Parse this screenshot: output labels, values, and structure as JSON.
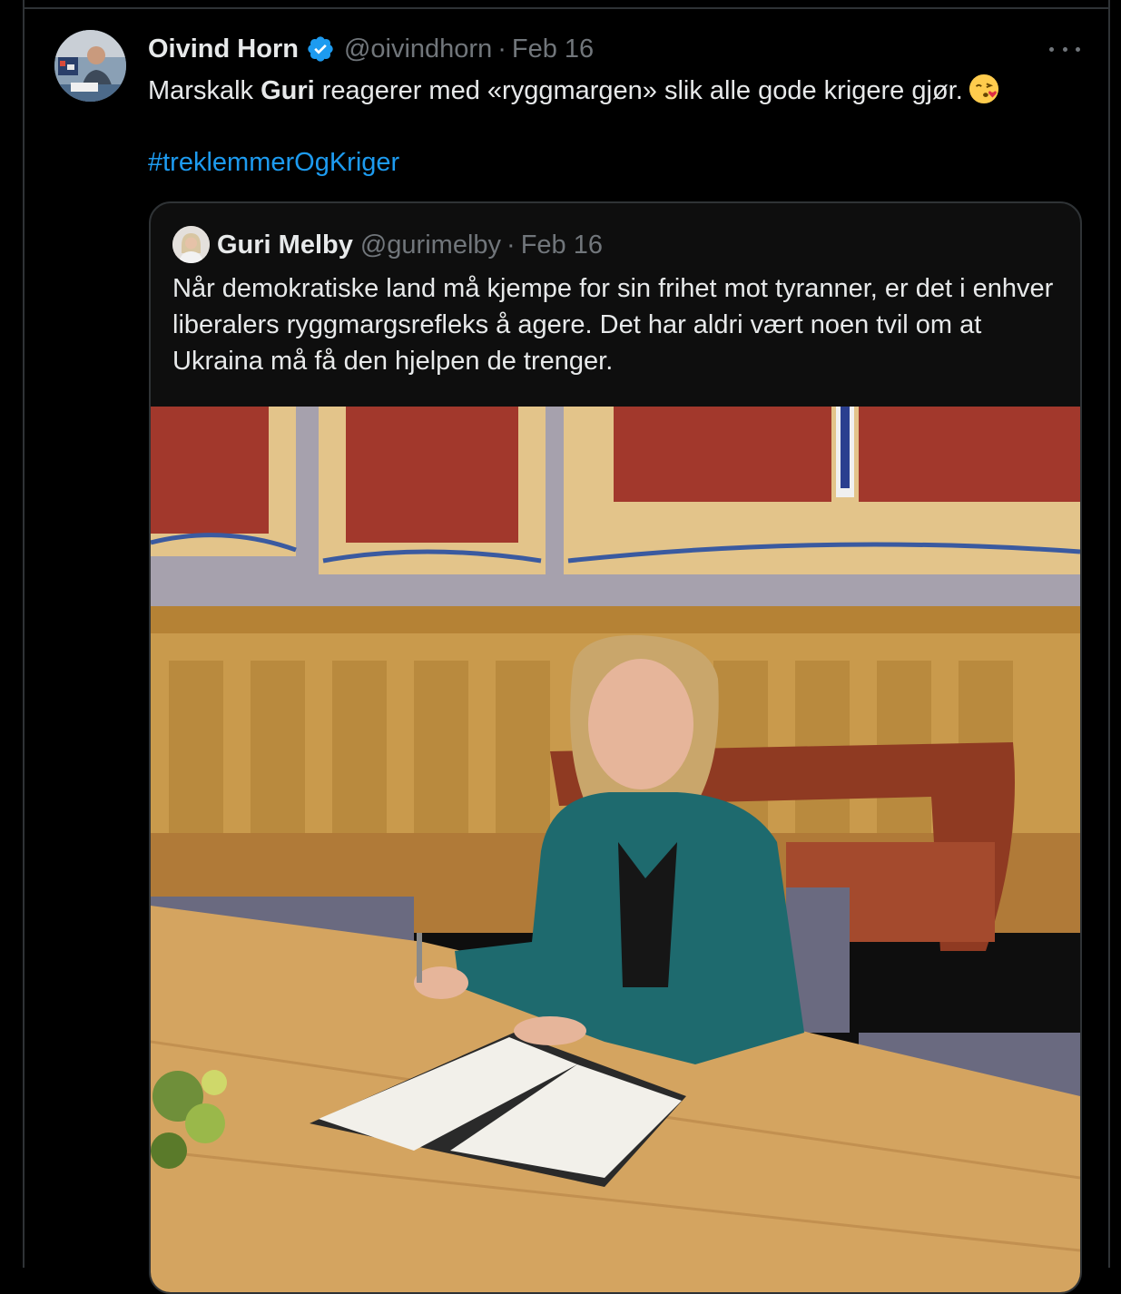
{
  "tweet": {
    "author_name": "Oivind Horn",
    "handle": "@oivindhorn",
    "separator": "·",
    "date": "Feb 16",
    "text_before": "Marskalk ",
    "text_bold": "Guri",
    "text_after": " reagerer med «ryggmargen» slik alle gode krigere gjør.",
    "emoji_icon": "face-blowing-kiss-icon",
    "hashtag": "#treklemmerOgKriger"
  },
  "quoted": {
    "author_name": "Guri Melby",
    "handle": "@gurimelby",
    "separator": "·",
    "date": "Feb 16",
    "text": "Når demokratiske land må kjempe for sin frihet mot tyranner, er det i enhver liberalers ryggmargsrefleks å agere. Det har aldri vært noen tvil om at Ukraina må få den hjelpen de trenger.",
    "media": "photo of woman in teal blazer signing a document at a wooden table in a wood-paneled room"
  },
  "colors": {
    "background": "#000000",
    "text": "#e7e9ea",
    "muted": "#71767b",
    "link": "#1d9bf0",
    "border": "#2f3336",
    "verified": "#1d9bf0"
  }
}
